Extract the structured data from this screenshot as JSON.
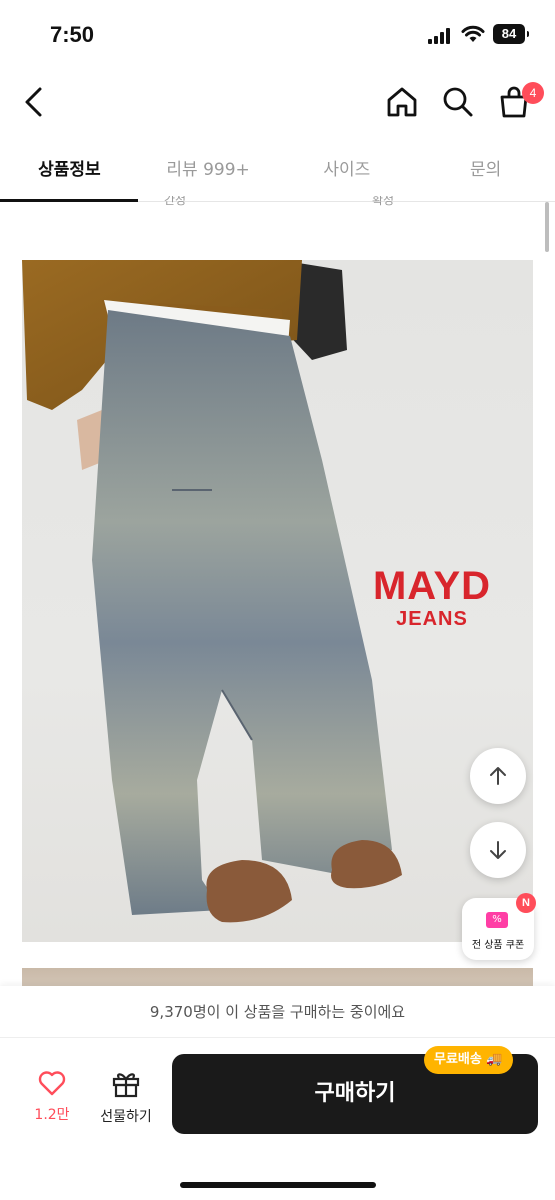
{
  "status_bar": {
    "time": "7:50",
    "battery": "84"
  },
  "header": {
    "cart_count": "4"
  },
  "tabs": [
    {
      "label": "상품정보",
      "active": true
    },
    {
      "label": "리뷰 999+",
      "active": false
    },
    {
      "label": "사이즈",
      "active": false
    },
    {
      "label": "문의",
      "active": false
    }
  ],
  "content": {
    "cut_text_1": "간정",
    "cut_text_2": "확정",
    "brand_line1": "MAYD",
    "brand_line2": "JEANS",
    "coupon_label": "전 상품 쿠폰",
    "coupon_badge": "N",
    "coupon_icon_text": "%"
  },
  "bottom_bar": {
    "buying_notice": "9,370명이 이 상품을 구매하는 중이에요",
    "like_count": "1.2만",
    "gift_label": "선물하기",
    "buy_label": "구매하기",
    "shipping_badge": "무료배송"
  },
  "colors": {
    "accent_red": "#ff4d5a",
    "brand_red": "#d8252c",
    "shipping_yellow": "#ffb400",
    "buy_button": "#1a1a1a"
  }
}
